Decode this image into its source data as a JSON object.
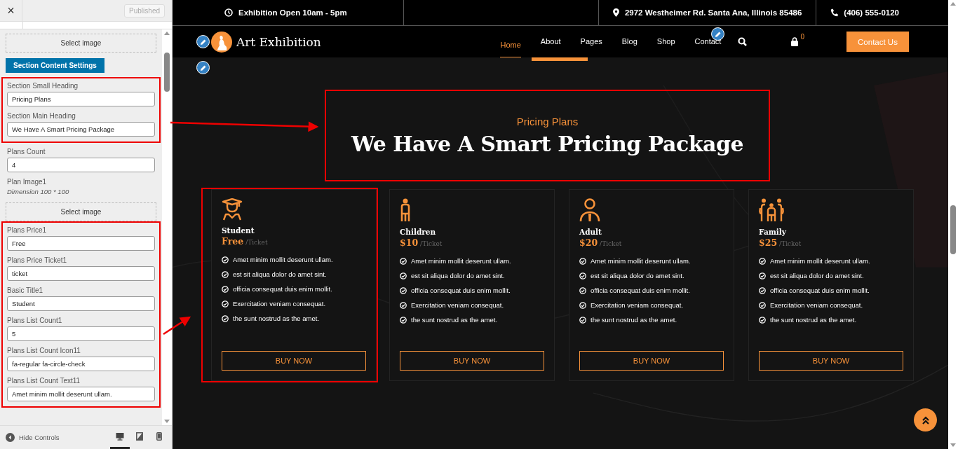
{
  "sidebar": {
    "close": "×",
    "publish_button": {
      "label": "Published",
      "disabled": true
    },
    "controls": [
      {
        "kind": "image_button",
        "label": "Select image"
      },
      {
        "kind": "section_button",
        "label": "Section Content Settings"
      },
      {
        "kind": "group",
        "highlighted": true,
        "fields": [
          {
            "label": "Section Small Heading",
            "value": "Pricing Plans"
          },
          {
            "label": "Section Main Heading",
            "value": "We Have A Smart Pricing Package"
          }
        ]
      },
      {
        "kind": "group",
        "highlighted": false,
        "fields": [
          {
            "label": "Plans Count",
            "value": "4"
          },
          {
            "label": "Plan Image1",
            "description": "Dimension 100 * 100"
          }
        ]
      },
      {
        "kind": "image_button",
        "label": "Select image"
      },
      {
        "kind": "group",
        "highlighted": true,
        "fields": [
          {
            "label": "Plans Price1",
            "value": "Free"
          },
          {
            "label": "Plans Price Ticket1",
            "value": "ticket"
          },
          {
            "label": "Basic Title1",
            "value": "Student"
          },
          {
            "label": "Plans List Count1",
            "value": "5"
          },
          {
            "label": "Plans List Count Icon11",
            "value": "fa-regular fa-circle-check"
          },
          {
            "label": "Plans List Count Text11",
            "value": "Amet minim mollit deserunt ullam."
          }
        ]
      }
    ],
    "footer": {
      "hide_controls": "Hide Controls",
      "devices": [
        {
          "kind": "desktop",
          "selected": true
        },
        {
          "kind": "tablet",
          "selected": false
        },
        {
          "kind": "mobile",
          "selected": false
        }
      ]
    }
  },
  "topbar": {
    "hours": "Exhibition Open 10am - 5pm",
    "address": "2972 Westheimer Rd. Santa Ana, Illinois 85486",
    "phone": "(406) 555-0120"
  },
  "nav": {
    "logo": "Art Exhibition",
    "items": [
      {
        "label": "Home",
        "selected": true
      },
      {
        "label": "About",
        "selected": false
      },
      {
        "label": "Pages",
        "selected": false
      },
      {
        "label": "Blog",
        "selected": false
      },
      {
        "label": "Shop",
        "selected": false
      },
      {
        "label": "Contact",
        "selected": false
      }
    ],
    "cart_count": "0",
    "cta": "Contact Us"
  },
  "pricing": {
    "small_heading": "Pricing Plans",
    "heading": "We Have A Smart Pricing Package",
    "heading_highlighted": true,
    "plans": [
      {
        "kind": "student",
        "title": "Student",
        "price": "Free",
        "ticket": "/Ticket",
        "highlighted": true,
        "features": [
          "Amet minim mollit deserunt ullam.",
          "est sit aliqua dolor do amet sint.",
          "officia consequat duis enim mollit.",
          "Exercitation veniam consequat.",
          "the sunt nostrud as the amet."
        ],
        "button": "BUY NOW"
      },
      {
        "kind": "child",
        "title": "Children",
        "price": "$10",
        "ticket": "/Ticket",
        "highlighted": false,
        "features": [
          "Amet minim mollit deserunt ullam.",
          "est sit aliqua dolor do amet sint.",
          "officia consequat duis enim mollit.",
          "Exercitation veniam consequat.",
          "the sunt nostrud as the amet."
        ],
        "button": "BUY NOW"
      },
      {
        "kind": "adult",
        "title": "Adult",
        "price": "$20",
        "ticket": "/Ticket",
        "highlighted": false,
        "features": [
          "Amet minim mollit deserunt ullam.",
          "est sit aliqua dolor do amet sint.",
          "officia consequat duis enim mollit.",
          "Exercitation veniam consequat.",
          "the sunt nostrud as the amet."
        ],
        "button": "BUY NOW"
      },
      {
        "kind": "family",
        "title": "Family",
        "price": "$25",
        "ticket": "/Ticket",
        "highlighted": false,
        "features": [
          "Amet minim mollit deserunt ullam.",
          "est sit aliqua dolor do amet sint.",
          "officia consequat duis enim mollit.",
          "Exercitation veniam consequat.",
          "the sunt nostrud as the amet."
        ],
        "button": "BUY NOW"
      }
    ]
  }
}
